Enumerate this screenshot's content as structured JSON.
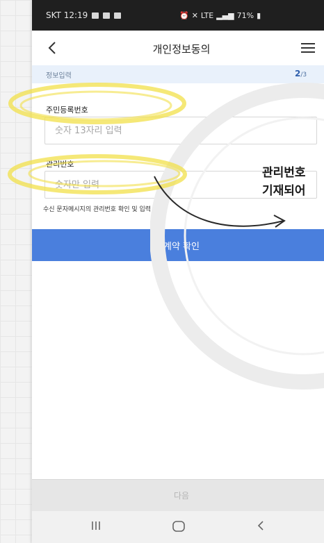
{
  "status_bar": {
    "carrier_time": "SKT 12:19",
    "battery": "71%",
    "network": "LTE"
  },
  "header": {
    "title": "개인정보동의",
    "back_icon": "chevron-left-icon",
    "menu_icon": "hamburger-menu-icon"
  },
  "progress": {
    "section": "정보입력",
    "current": "2",
    "total": "/3"
  },
  "form": {
    "rrn_label": "주민등록번호",
    "rrn_placeholder": "숫자 13자리 입력",
    "mgmt_label": "관리번호",
    "mgmt_placeholder": "숫자만 입력",
    "hint": "수신 문자메시지의 관리번호 확인 및 입력"
  },
  "buttons": {
    "confirm": "계약 확인",
    "next": "다음"
  },
  "annotation": {
    "line1": "관리번호",
    "line2": "기재되어"
  },
  "colors": {
    "primary_button": "#4a7fdd",
    "highlight": "#f2e04a",
    "status_bar": "#1f1f1f"
  }
}
